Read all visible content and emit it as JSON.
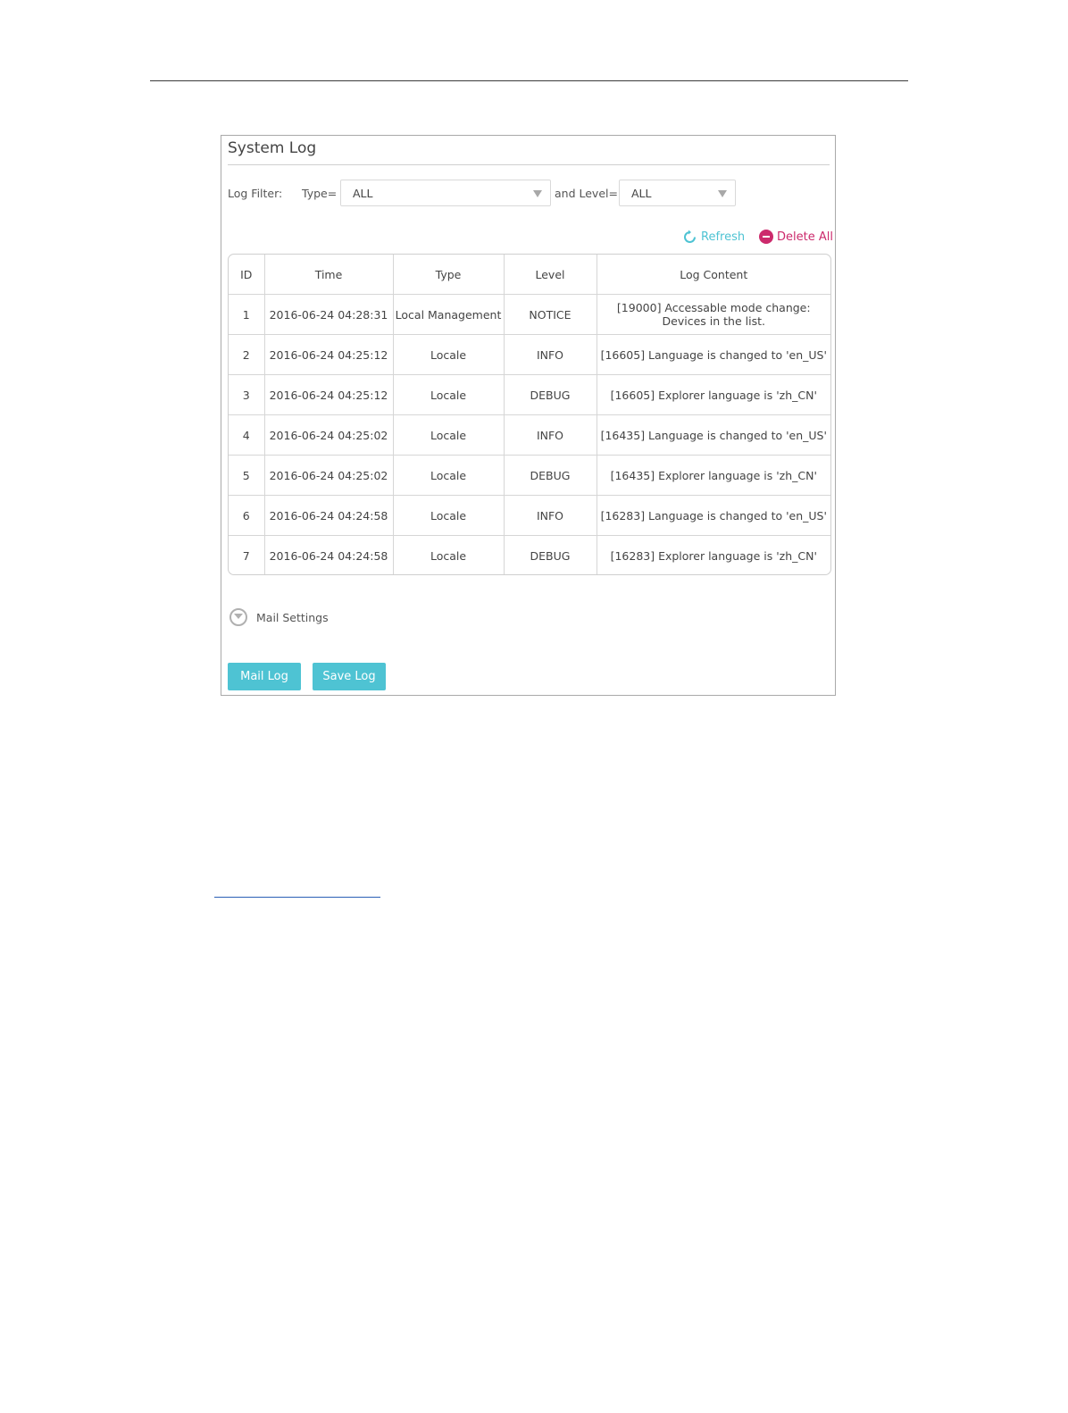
{
  "panel": {
    "title": "System Log"
  },
  "filter": {
    "label": "Log Filter:",
    "type_label": "Type=",
    "type_value": "ALL",
    "level_label": "and Level=",
    "level_value": "ALL"
  },
  "actions": {
    "refresh": "Refresh",
    "delete_all": "Delete All",
    "refresh_color": "#4ec3d3",
    "delete_color": "#cc2a6c"
  },
  "table": {
    "headers": [
      "ID",
      "Time",
      "Type",
      "Level",
      "Log Content"
    ],
    "rows": [
      [
        "1",
        "2016-06-24 04:28:31",
        "Local Management",
        "NOTICE",
        "[19000] Accessable mode change: Devices in the list."
      ],
      [
        "2",
        "2016-06-24 04:25:12",
        "Locale",
        "INFO",
        "[16605] Language is changed to 'en_US'"
      ],
      [
        "3",
        "2016-06-24 04:25:12",
        "Locale",
        "DEBUG",
        "[16605] Explorer language is 'zh_CN'"
      ],
      [
        "4",
        "2016-06-24 04:25:02",
        "Locale",
        "INFO",
        "[16435] Language is changed to 'en_US'"
      ],
      [
        "5",
        "2016-06-24 04:25:02",
        "Locale",
        "DEBUG",
        "[16435] Explorer language is 'zh_CN'"
      ],
      [
        "6",
        "2016-06-24 04:24:58",
        "Locale",
        "INFO",
        "[16283] Language is changed to 'en_US'"
      ],
      [
        "7",
        "2016-06-24 04:24:58",
        "Locale",
        "DEBUG",
        "[16283] Explorer language is 'zh_CN'"
      ]
    ]
  },
  "mail_settings": {
    "label": "Mail Settings",
    "icon": "chevron-down-circle-icon"
  },
  "buttons": {
    "mail_log": "Mail Log",
    "save_log": "Save Log",
    "accent": "#4ec3d3"
  }
}
